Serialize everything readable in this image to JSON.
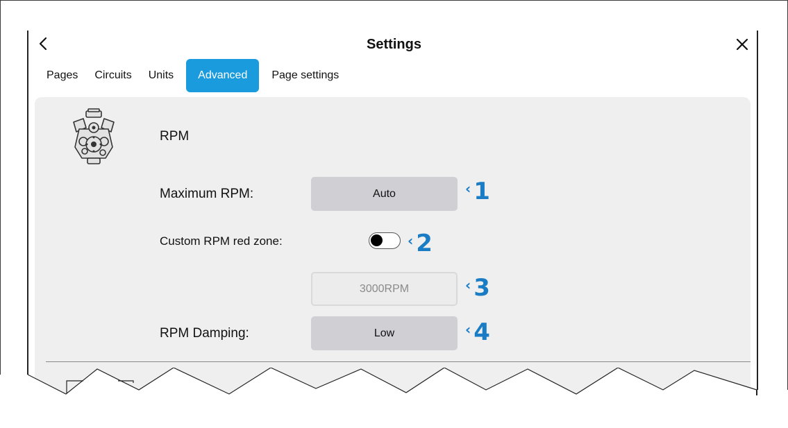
{
  "header": {
    "title": "Settings"
  },
  "tabs": [
    {
      "label": "Pages",
      "active": false
    },
    {
      "label": "Circuits",
      "active": false
    },
    {
      "label": "Units",
      "active": false
    },
    {
      "label": "Advanced",
      "active": true
    },
    {
      "label": "Page settings",
      "active": false
    }
  ],
  "section": {
    "title": "RPM",
    "icon": "engine-icon"
  },
  "settings": {
    "max_rpm": {
      "label": "Maximum RPM:",
      "value": "Auto"
    },
    "red_zone": {
      "label": "Custom RPM red zone:",
      "enabled": false
    },
    "red_zone_value": {
      "value": "3000RPM"
    },
    "damping": {
      "label": "RPM Damping:",
      "value": "Low"
    }
  },
  "callouts": [
    "1",
    "2",
    "3",
    "4"
  ],
  "colors": {
    "accent": "#1a9bdd",
    "callout": "#1a7cc4",
    "panel": "#efefef",
    "button": "#cfcfd4"
  }
}
